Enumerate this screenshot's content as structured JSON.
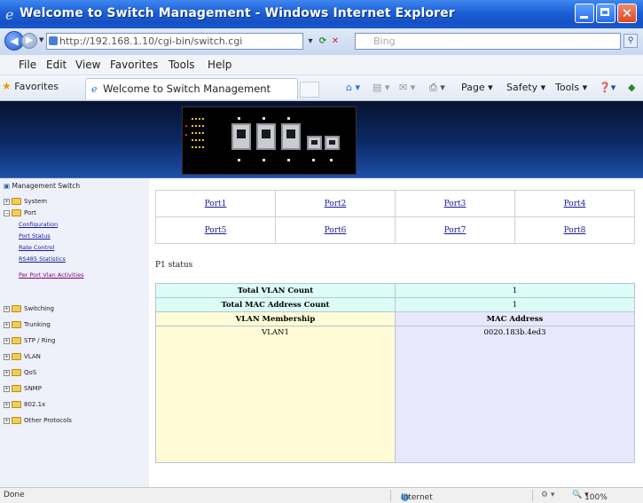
{
  "window": {
    "title": "Welcome to Switch Management - Windows Internet Explorer",
    "close_glyph": "✕"
  },
  "address_bar": {
    "url": "http://192.168.1.10/cgi-bin/switch.cgi",
    "search_placeholder": "Bing"
  },
  "menu": [
    "File",
    "Edit",
    "View",
    "Favorites",
    "Tools",
    "Help"
  ],
  "favorites_bar": {
    "favorites_label": "Favorites",
    "tab_title": "Welcome to Switch Management",
    "commands": [
      "Page ▾",
      "Safety ▾",
      "Tools ▾"
    ]
  },
  "sidebar": {
    "root": "Management Switch",
    "items": [
      {
        "label": "System",
        "pm": "+"
      },
      {
        "label": "Port",
        "pm": "−"
      },
      {
        "label": "Switching",
        "pm": "+"
      },
      {
        "label": "Trunking",
        "pm": "+"
      },
      {
        "label": "STP / Ring",
        "pm": "+"
      },
      {
        "label": "VLAN",
        "pm": "+"
      },
      {
        "label": "QoS",
        "pm": "+"
      },
      {
        "label": "SNMP",
        "pm": "+"
      },
      {
        "label": "802.1x",
        "pm": "+"
      },
      {
        "label": "Other Protocols",
        "pm": "+"
      }
    ],
    "port_sub": [
      "Configuration",
      "Port Status",
      "Rate Control",
      "RS485 Statistics",
      "Per Port Vlan Activities"
    ]
  },
  "ports": [
    [
      "Port1",
      "Port2",
      "Port3",
      "Port4"
    ],
    [
      "Port5",
      "Port6",
      "Port7",
      "Port8"
    ]
  ],
  "status_title": "P1 status",
  "stats": {
    "total_vlan_label": "Total VLAN Count",
    "total_vlan_value": "1",
    "total_mac_label": "Total MAC Address Count",
    "total_mac_value": "1",
    "vlan_header": "VLAN Membership",
    "mac_header": "MAC Address",
    "vlan_value": "VLAN1",
    "mac_value": "0020.183b.4ed3"
  },
  "statusbar": {
    "left": "Done",
    "zone": "Internet",
    "zoom": "100%"
  }
}
